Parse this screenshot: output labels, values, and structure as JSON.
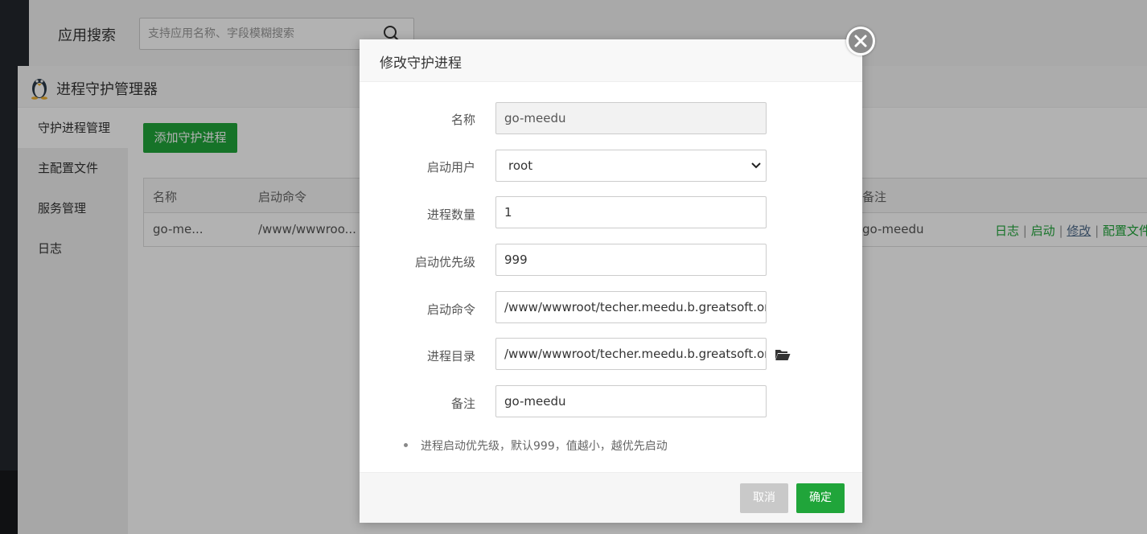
{
  "app_search": {
    "label": "应用搜索",
    "placeholder": "支持应用名称、字段模糊搜索"
  },
  "panel": {
    "title": "进程守护管理器",
    "sidebar": [
      {
        "label": "守护进程管理",
        "active": true
      },
      {
        "label": "主配置文件",
        "active": false
      },
      {
        "label": "服务管理",
        "active": false
      },
      {
        "label": "日志",
        "active": false
      }
    ],
    "add_button": "添加守护进程",
    "table": {
      "headers": {
        "name": "名称",
        "command": "启动命令",
        "remark": "备注"
      },
      "row": {
        "name": "go-me...",
        "command": "/www/wwwroo...",
        "remark": "go-meedu",
        "ops": [
          "日志",
          "启动",
          "修改",
          "配置文件"
        ],
        "separator": "|"
      }
    }
  },
  "modal": {
    "title": "修改守护进程",
    "fields": {
      "name": {
        "label": "名称",
        "value": "go-meedu"
      },
      "user": {
        "label": "启动用户",
        "value": "root"
      },
      "count": {
        "label": "进程数量",
        "value": "1"
      },
      "priority": {
        "label": "启动优先级",
        "value": "999"
      },
      "command": {
        "label": "启动命令",
        "value": "/www/wwwroot/techer.meedu.b.greatsoft.org"
      },
      "directory": {
        "label": "进程目录",
        "value": "/www/wwwroot/techer.meedu.b.greatsoft.org"
      },
      "remark": {
        "label": "备注",
        "value": "go-meedu"
      }
    },
    "tip": "进程启动优先级，默认999，值越小，越优先启动",
    "cancel": "取消",
    "confirm": "确定"
  },
  "colors": {
    "accent": "#20a53a",
    "cancel": "#c9c9c9",
    "link_active": "#4e6a8a"
  }
}
